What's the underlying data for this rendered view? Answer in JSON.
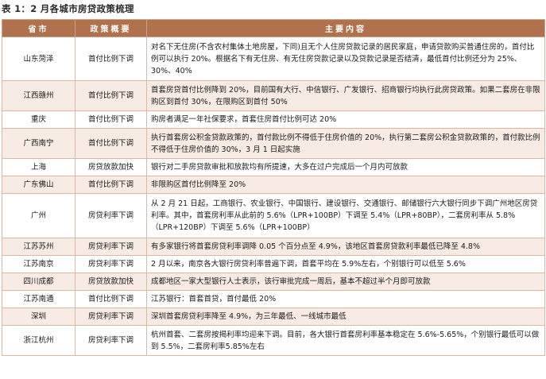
{
  "title": "表 1：2 月各城市房贷政策梳理",
  "headers": {
    "city": "省市",
    "policy": "政策概要",
    "content": "主要内容"
  },
  "rows": [
    {
      "city": "山东菏泽",
      "policy": "首付比例下调",
      "content": "对名下无住房(不含农村集体土地房屋，下同)且无个人住房贷款记录的居民家庭，申请贷款购买普通住房的，首付比例可以执行 20%。根据名下有无住房、有无住房贷款记录以及贷款记录是否结清，最低首付比例还分为 25%、30%、40%"
    },
    {
      "city": "江西赣州",
      "policy": "首付比例下调",
      "content": "首套房贷首付比例降到 20%，目前国有大行、中信银行、广发银行、招商银行均执行此房贷政策。如果二套房在非限购区到首付 30%，在限购区到首付 50%"
    },
    {
      "city": "重庆",
      "policy": "首付比例下调",
      "content": "购房者满足一年社保要求，首套住房首付比例可达 20%"
    },
    {
      "city": "广西南宁",
      "policy": "首付比例下调",
      "content": "执行首套房公积金贷款政策的，首付款比例不得低于住房价值的 20%，执行第二套房公积金贷款政策的，首付款比例不得低于住房价值的 30%，3 月 1 日起实施"
    },
    {
      "city": "上海",
      "policy": "房贷放款加快",
      "content": "银行对二手房贷款审批和放款均有所提速，大多在过户完成后一个月内可放款"
    },
    {
      "city": "广东佛山",
      "policy": "首付比例下调",
      "content": "非限购区首付比例降至 20%"
    },
    {
      "city": "广州",
      "policy": "房贷利率下调",
      "content": "从 2 月 21 日起，工商银行、农业银行、中国银行、建设银行、交通银行、邮储银行六大银行同步下调广州地区房贷利率。其中，首套房利率从此前的 5.6%（LPR+100BP）下调至 5.4%（LPR+80BP），二套房利率从 5.8%（LPR+120BP）下调至 5.6%（LPR+100BP）"
    },
    {
      "city": "江苏苏州",
      "policy": "房贷利率下调",
      "content": "有多家银行将首套房贷利率调降 0.05 个百分点至 4.9%，该地区首套房贷款利率最低已降至 4.8%"
    },
    {
      "city": "江苏南京",
      "policy": "房贷利率下调",
      "content": "2 月以来，南京各大银行房贷利率普遍下调，首套平均在 5.9%左右，个别银行可以低至 5.6%"
    },
    {
      "city": "四川成都",
      "policy": "房贷放款加快",
      "content": "成都地区一家大型银行人士表示，该行审批完成一周后，基本不超过半个月即可放款"
    },
    {
      "city": "江苏南通",
      "policy": "首付比例下调",
      "content": "江苏银行：首套首贷，首付最低 20%"
    },
    {
      "city": "深圳",
      "policy": "房贷利率下调",
      "content": "深圳首套房贷利率降至 4.9%，为三年最低、一线城市最低"
    },
    {
      "city": "浙江杭州",
      "policy": "房贷利率下调",
      "content": "杭州首套、二套房按揭利率均迎来下调。目前，各大银行首套房利率基本稳定在 5.6%-5.65%，个别银行最低可以做到 5.5%，二套房利率5.85%左右"
    }
  ]
}
